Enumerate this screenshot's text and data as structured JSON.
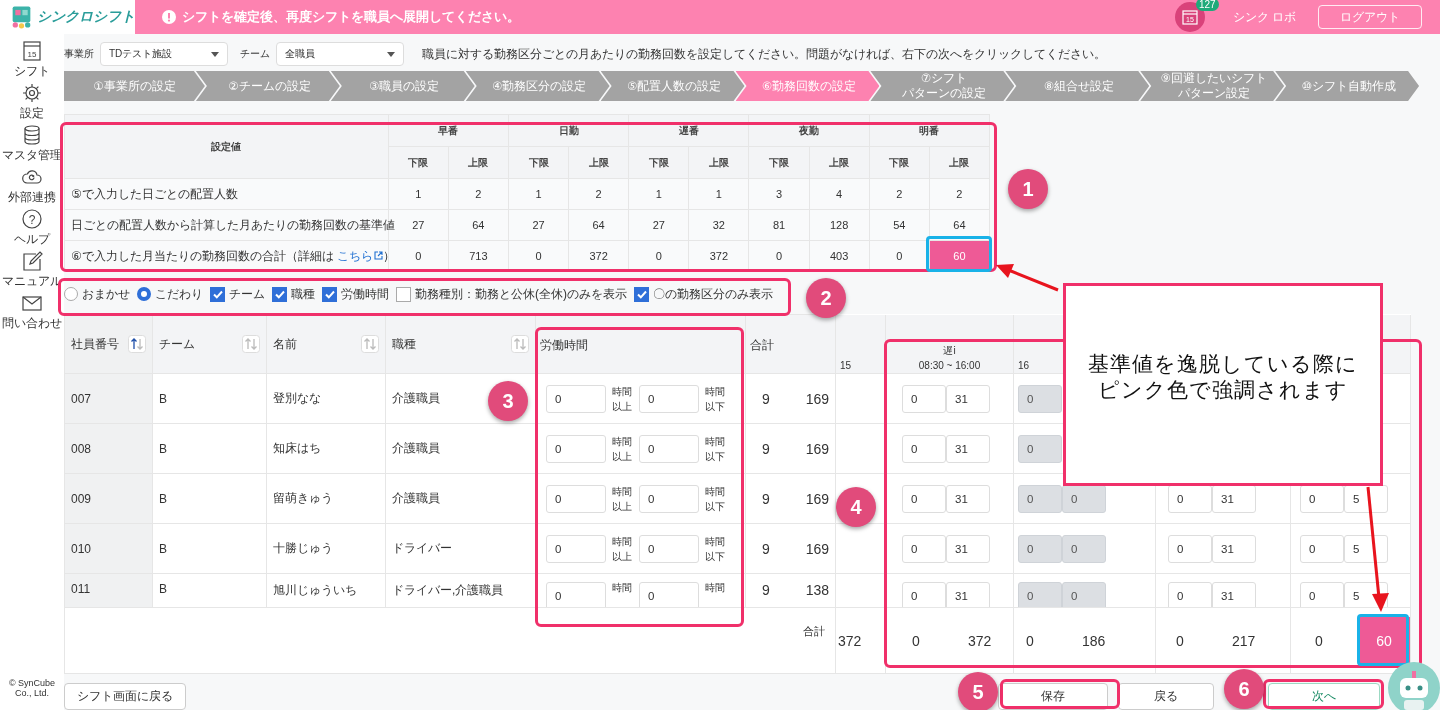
{
  "header": {
    "app_name": "シンクロシフト",
    "notice": "シフトを確定後、再度シフトを職員へ展開してください。",
    "calendar_text": "15",
    "badge": "127",
    "user": "シンク ロボ",
    "logout": "ログアウト"
  },
  "sidebar": {
    "items": [
      {
        "icon_text": "15",
        "label": "シフト"
      },
      {
        "label": "設定"
      },
      {
        "label": "マスタ管理"
      },
      {
        "label": "外部連携"
      },
      {
        "icon_text": "?",
        "label": "ヘルプ"
      },
      {
        "label": "マニュアル"
      },
      {
        "label": "問い合わせ"
      }
    ],
    "copyright": "© SynCube Co., Ltd."
  },
  "filters": [
    {
      "label": "事業所",
      "value": "TDテスト施設"
    },
    {
      "label": "チーム",
      "value": "全職員"
    }
  ],
  "instruction": "職員に対する勤務区分ごとの月あたりの勤務回数を設定してください。問題がなければ、右下の次へをクリックしてください。",
  "steps": [
    {
      "lines": [
        "①事業所の設定"
      ],
      "selected": false
    },
    {
      "lines": [
        "②チームの設定"
      ],
      "selected": false
    },
    {
      "lines": [
        "③職員の設定"
      ],
      "selected": false
    },
    {
      "lines": [
        "④勤務区分の設定"
      ],
      "selected": false
    },
    {
      "lines": [
        "⑤配置人数の設定"
      ],
      "selected": false
    },
    {
      "lines": [
        "⑥勤務回数の設定"
      ],
      "selected": true
    },
    {
      "lines": [
        "⑦シフト",
        "パターンの設定"
      ],
      "selected": false
    },
    {
      "lines": [
        "⑧組合せ設定"
      ],
      "selected": false
    },
    {
      "lines": [
        "⑨回避したいシフト",
        "パターン設定"
      ],
      "selected": false
    },
    {
      "lines": [
        "⑩シフト自動作成"
      ],
      "selected": false
    }
  ],
  "summary": {
    "corner": "設定値",
    "groups": [
      {
        "name": "早番",
        "lower": "下限",
        "upper": "上限"
      },
      {
        "name": "日勤",
        "lower": "下限",
        "upper": "上限"
      },
      {
        "name": "遅番",
        "lower": "下限",
        "upper": "上限"
      },
      {
        "name": "夜勤",
        "lower": "下限",
        "upper": "上限"
      },
      {
        "name": "明番",
        "lower": "下限",
        "upper": "上限"
      }
    ],
    "rows": [
      {
        "label": "⑤で入力した日ごとの配置人数",
        "values": [
          "1",
          "2",
          "1",
          "2",
          "1",
          "1",
          "3",
          "4",
          "2",
          "2"
        ]
      },
      {
        "label": "日ごとの配置人数から計算した月あたりの勤務回数の基準値",
        "values": [
          "27",
          "64",
          "27",
          "64",
          "27",
          "32",
          "81",
          "128",
          "54",
          "64"
        ]
      },
      {
        "label": "⑥で入力した月当たりの勤務回数の合計（詳細は ",
        "link": "こちら",
        "label_end": "）",
        "values": [
          {
            "text": "0",
            "highlighted": false
          },
          {
            "text": "713",
            "highlighted": false
          },
          {
            "text": "0",
            "highlighted": false
          },
          {
            "text": "372",
            "highlighted": false
          },
          {
            "text": "0",
            "highlighted": false
          },
          {
            "text": "372",
            "highlighted": false
          },
          {
            "text": "0",
            "highlighted": false
          },
          {
            "text": "403",
            "highlighted": false
          },
          {
            "text": "0",
            "highlighted": false
          },
          {
            "text": "60",
            "highlighted": true
          }
        ]
      }
    ]
  },
  "options": [
    {
      "kind": "radio",
      "label": "おまかせ",
      "selected": false
    },
    {
      "kind": "radio",
      "label": "こだわり",
      "selected": true
    },
    {
      "kind": "checkbox",
      "label": "チーム",
      "checked": true
    },
    {
      "kind": "checkbox",
      "label": "職種",
      "checked": true
    },
    {
      "kind": "checkbox",
      "label": "労働時間",
      "checked": true
    },
    {
      "kind": "checkbox",
      "label": "勤務種別：勤務と公休(全休)のみを表示",
      "checked": false
    },
    {
      "kind": "checkbox",
      "label": "〇の勤務区分のみ表示",
      "checked": true
    }
  ],
  "table": {
    "columns": [
      {
        "label": "社員番号",
        "sorted": true
      },
      {
        "label": "チーム",
        "sorted": false
      },
      {
        "label": "名前",
        "sorted": false
      },
      {
        "label": "職種",
        "sorted": false
      }
    ],
    "hours_header": "労働時間",
    "total_header": "合計",
    "shift_columns": [
      {
        "kind": "partial",
        "header": "15",
        "total": {
          "max": "372",
          "highlighted": false
        }
      },
      {
        "kind": "full",
        "header": "遅i",
        "time": "08:30 ~ 16:00",
        "total": {
          "min": "0",
          "max": "372",
          "highlighted": false
        }
      },
      {
        "kind": "partial",
        "header": "16",
        "total": {
          "min": "0",
          "max": "186",
          "highlighted": false
        }
      },
      {
        "kind": "covered",
        "total": {
          "min": "0",
          "max": "217",
          "highlighted": false
        }
      },
      {
        "kind": "covered",
        "total": {
          "min": "0",
          "max": "60",
          "highlighted": true
        }
      }
    ],
    "rows": [
      {
        "id": "007",
        "team": "B",
        "name": "登別なな",
        "job": "介護職員",
        "hours": {
          "min": "0",
          "min_unit": "時間以上",
          "max": "0",
          "max_unit": "時間以下"
        },
        "days": "9",
        "total": "169",
        "shifts": [
          {
            "min": "0",
            "max": "31",
            "disabled": false
          },
          {
            "min": "0",
            "disabled": true
          }
        ]
      },
      {
        "id": "008",
        "team": "B",
        "name": "知床はち",
        "job": "介護職員",
        "hours": {
          "min": "0",
          "min_unit": "時間以上",
          "max": "0",
          "max_unit": "時間以下"
        },
        "days": "9",
        "total": "169",
        "shifts": [
          {
            "min": "0",
            "max": "31",
            "disabled": false
          },
          {
            "min": "0",
            "disabled": true
          }
        ]
      },
      {
        "id": "009",
        "team": "B",
        "name": "留萌きゅう",
        "job": "介護職員",
        "hours": {
          "min": "0",
          "min_unit": "時間以上",
          "max": "0",
          "max_unit": "時間以下"
        },
        "days": "9",
        "total": "169",
        "shifts": [
          {
            "min": "0",
            "max": "31",
            "disabled": false
          },
          {
            "min": "0",
            "max": "0",
            "disabled": true
          },
          {
            "min": "0",
            "max": "31",
            "disabled": false
          },
          {
            "min": "0",
            "max": "5",
            "disabled": false
          }
        ]
      },
      {
        "id": "010",
        "team": "B",
        "name": "十勝じゅう",
        "job": "ドライバー",
        "hours": {
          "min": "0",
          "min_unit": "時間以上",
          "max": "0",
          "max_unit": "時間以下"
        },
        "days": "9",
        "total": "169",
        "shifts": [
          {
            "min": "0",
            "max": "31",
            "disabled": false
          },
          {
            "min": "0",
            "max": "0",
            "disabled": true
          },
          {
            "min": "0",
            "max": "31",
            "disabled": false
          },
          {
            "min": "0",
            "max": "5",
            "disabled": false
          }
        ]
      },
      {
        "id": "011",
        "team": "B",
        "name": "旭川じゅういち",
        "job": "ドライバー,介護職員",
        "hours": {
          "min": "0",
          "min_unit": "時間",
          "max": "0",
          "max_unit": "時間"
        },
        "days": "9",
        "total": "138",
        "clipped": true,
        "shifts": [
          {
            "min": "0",
            "max": "31",
            "disabled": false
          },
          {
            "min": "0",
            "max": "0",
            "disabled": true
          },
          {
            "min": "0",
            "max": "31",
            "disabled": false
          },
          {
            "min": "0",
            "max": "5",
            "disabled": false
          }
        ]
      }
    ],
    "footer_label": "合計"
  },
  "buttons": {
    "back_to_shift": "シフト画面に戻る",
    "save": "保存",
    "back": "戻る",
    "next": "次へ"
  },
  "annotations": {
    "markers": [
      "1",
      "2",
      "3",
      "4",
      "5",
      "6"
    ],
    "callout": [
      "基準値を逸脱している際に",
      "ピンク色で強調されます"
    ]
  }
}
